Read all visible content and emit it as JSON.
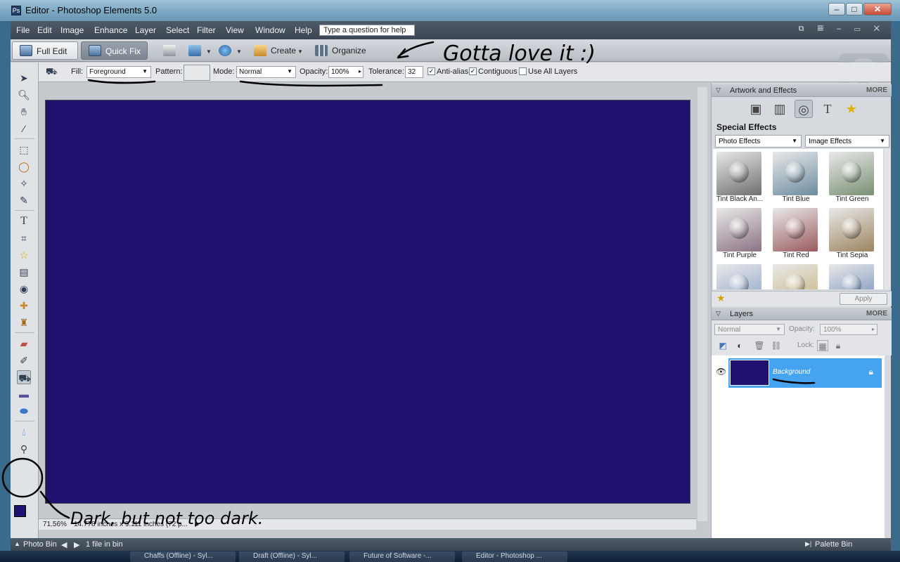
{
  "window": {
    "title": "Editor - Photoshop Elements 5.0"
  },
  "menu": {
    "items": [
      "File",
      "Edit",
      "Image",
      "Enhance",
      "Layer",
      "Select",
      "Filter",
      "View",
      "Window",
      "Help"
    ],
    "help_placeholder": "Type a question for help"
  },
  "modebar": {
    "full_edit": "Full Edit",
    "quick_fix": "Quick Fix",
    "create": "Create",
    "organize": "Organize"
  },
  "options": {
    "fill_label": "Fill:",
    "fill_value": "Foreground",
    "pattern_label": "Pattern:",
    "mode_label": "Mode:",
    "mode_value": "Normal",
    "opacity_label": "Opacity:",
    "opacity_value": "100%",
    "tolerance_label": "Tolerance:",
    "tolerance_value": "32",
    "anti_alias": "Anti-alias",
    "contiguous": "Contiguous",
    "use_all_layers": "Use All Layers"
  },
  "colors": {
    "canvas": "#1f1170",
    "foreground": "#1f1170",
    "background": "#ffffff",
    "layer_selected": "#46a3f0"
  },
  "status": {
    "zoom": "71.56%",
    "doc_info": "14.778 inches x 9.111 inches (72 p..."
  },
  "artwork_panel": {
    "title": "Artwork and Effects",
    "more": "MORE",
    "section": "Special Effects",
    "category": "Photo Effects",
    "subcategory": "Image Effects",
    "apply": "Apply",
    "effects": [
      {
        "label": "Tint Black An...",
        "tint": "#6f6f6f"
      },
      {
        "label": "Tint Blue",
        "tint": "#6d8ca0"
      },
      {
        "label": "Tint Green",
        "tint": "#7a9074"
      },
      {
        "label": "Tint Purple",
        "tint": "#8b7384"
      },
      {
        "label": "Tint Red",
        "tint": "#9a5a5e"
      },
      {
        "label": "Tint Sepia",
        "tint": "#9c8460"
      },
      {
        "label": "",
        "tint": "#8aa0c8"
      },
      {
        "label": "",
        "tint": "#c4b27a"
      },
      {
        "label": "",
        "tint": "#6e8ab8"
      }
    ]
  },
  "layers_panel": {
    "title": "Layers",
    "more": "MORE",
    "blend_mode": "Normal",
    "opacity_label": "Opacity:",
    "opacity_value": "100%",
    "lock_label": "Lock:",
    "layer_name": "Background"
  },
  "bottombar": {
    "photo_bin": "Photo Bin",
    "files": "1 file in bin",
    "palette_bin": "Palette Bin"
  },
  "annotations": {
    "top": "Gotta love it :)",
    "bottom": "Dark, but not too dark."
  },
  "taskbar": [
    "Chaffs (Offline) - Syl...",
    "Draft (Offline) - Syl...",
    "Future of Software -...",
    "Editor - Photoshop ..."
  ]
}
